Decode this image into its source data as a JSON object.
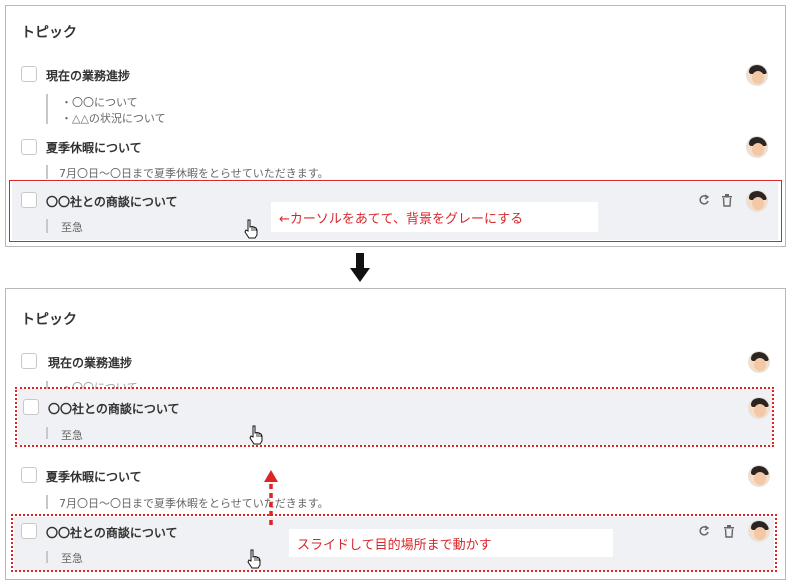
{
  "top": {
    "title": "トピック",
    "items": [
      {
        "title": "現在の業務進捗",
        "notes": [
          "・〇〇について",
          "・△△の状況について"
        ]
      },
      {
        "title": "夏季休暇について",
        "notes": [
          "7月〇日〜〇日まで夏季休暇をとらせていただきます。"
        ]
      },
      {
        "title": "〇〇社との商談について",
        "notes": [
          "至急"
        ]
      }
    ],
    "callout": "←カーソルをあてて、背景をグレーにする"
  },
  "bottom": {
    "title": "トピック",
    "items": [
      {
        "title": "現在の業務進捗",
        "notes": [
          "・〇〇について"
        ]
      },
      {
        "title": "〇〇社との商談について",
        "notes": [
          "至急"
        ]
      },
      {
        "title": "夏季休暇について",
        "notes": [
          "7月〇日〜〇日まで夏季休暇をとらせていただきます。"
        ]
      },
      {
        "title": "〇〇社との商談について",
        "notes": [
          "至急"
        ]
      }
    ],
    "callout": "スライドして目的場所まで動かす"
  },
  "icons": {
    "reply": "reply-icon",
    "delete": "trash-icon",
    "avatar": "avatar-icon",
    "cursor": "hand-cursor-icon"
  },
  "colors": {
    "highlight": "#d9262a",
    "hover_bg": "#f0f1f4"
  }
}
